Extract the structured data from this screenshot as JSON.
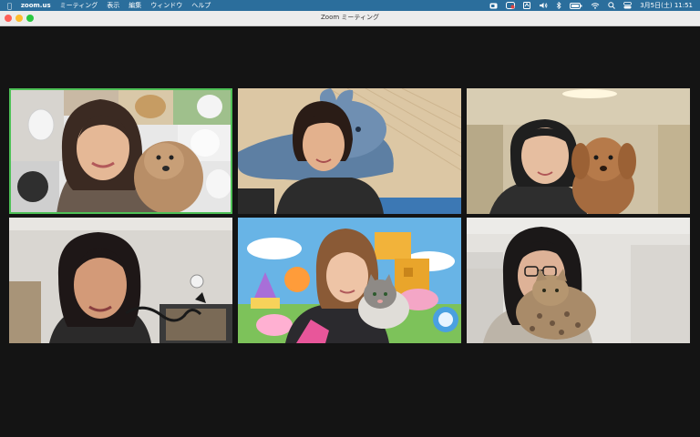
{
  "menubar": {
    "app_name": "zoom.us",
    "menus": [
      "ミーティング",
      "表示",
      "編集",
      "ウィンドウ",
      "ヘルプ"
    ],
    "date_time": "3月5日(土) 11:51"
  },
  "window": {
    "title": "Zoom ミーティング"
  },
  "colors": {
    "active_speaker_border": "#4ec157",
    "menubar": "#2b6e9c",
    "titlebar": "#ececec",
    "background": "#141414"
  },
  "participants": [
    {
      "tile": 1,
      "active_speaker": true
    },
    {
      "tile": 2,
      "active_speaker": false
    },
    {
      "tile": 3,
      "active_speaker": false
    },
    {
      "tile": 4,
      "active_speaker": false
    },
    {
      "tile": 5,
      "active_speaker": false
    },
    {
      "tile": 6,
      "active_speaker": false
    }
  ]
}
